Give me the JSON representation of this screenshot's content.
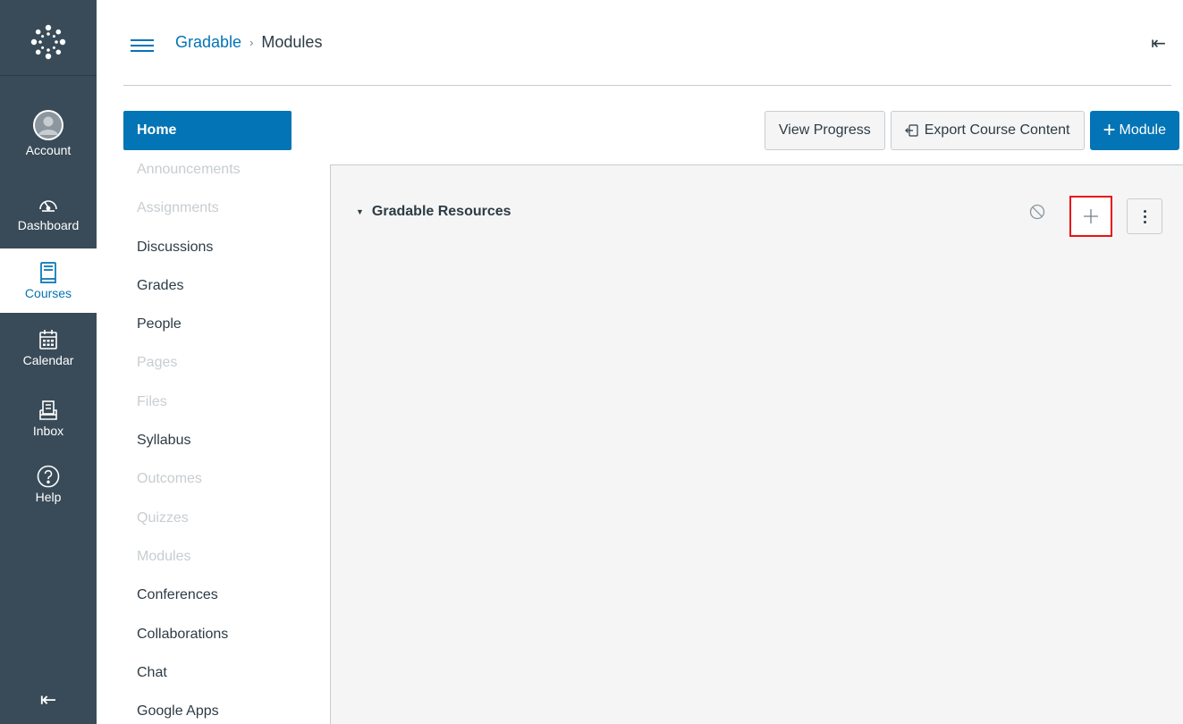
{
  "global_nav": {
    "logo_icon": "canvas-logo-icon",
    "items": [
      {
        "label": "Account",
        "icon": "avatar-icon",
        "active": false
      },
      {
        "label": "Dashboard",
        "icon": "dashboard-gauge-icon",
        "active": false
      },
      {
        "label": "Courses",
        "icon": "courses-book-icon",
        "active": true
      },
      {
        "label": "Calendar",
        "icon": "calendar-icon",
        "active": false
      },
      {
        "label": "Inbox",
        "icon": "inbox-icon",
        "active": false
      },
      {
        "label": "Help",
        "icon": "help-question-icon",
        "active": false
      }
    ],
    "collapse_glyph": "⇤"
  },
  "header": {
    "breadcrumb": [
      {
        "label": "Gradable",
        "link": true
      },
      {
        "label": "Modules",
        "link": false
      }
    ],
    "separator": "›",
    "collapse_glyph": "⇤"
  },
  "course_nav": {
    "items": [
      {
        "label": "Home",
        "state": "active"
      },
      {
        "label": "Announcements",
        "state": "disabled"
      },
      {
        "label": "Assignments",
        "state": "disabled"
      },
      {
        "label": "Discussions",
        "state": "normal"
      },
      {
        "label": "Grades",
        "state": "normal"
      },
      {
        "label": "People",
        "state": "normal"
      },
      {
        "label": "Pages",
        "state": "disabled"
      },
      {
        "label": "Files",
        "state": "disabled"
      },
      {
        "label": "Syllabus",
        "state": "normal"
      },
      {
        "label": "Outcomes",
        "state": "disabled"
      },
      {
        "label": "Quizzes",
        "state": "disabled"
      },
      {
        "label": "Modules",
        "state": "disabled"
      },
      {
        "label": "Conferences",
        "state": "normal"
      },
      {
        "label": "Collaborations",
        "state": "normal"
      },
      {
        "label": "Chat",
        "state": "normal"
      },
      {
        "label": "Google Apps",
        "state": "normal"
      }
    ]
  },
  "toolbar": {
    "view_progress_label": "View Progress",
    "export_label": "Export Course Content",
    "module_label": "Module",
    "module_plus": "+"
  },
  "module": {
    "title": "Gradable Resources",
    "caret": "▼",
    "add_glyph": "+"
  },
  "colors": {
    "nav_bg": "#394b58",
    "brand_blue": "#0374b5",
    "highlight_red": "#e8111a",
    "module_bg": "#f5f5f5"
  }
}
